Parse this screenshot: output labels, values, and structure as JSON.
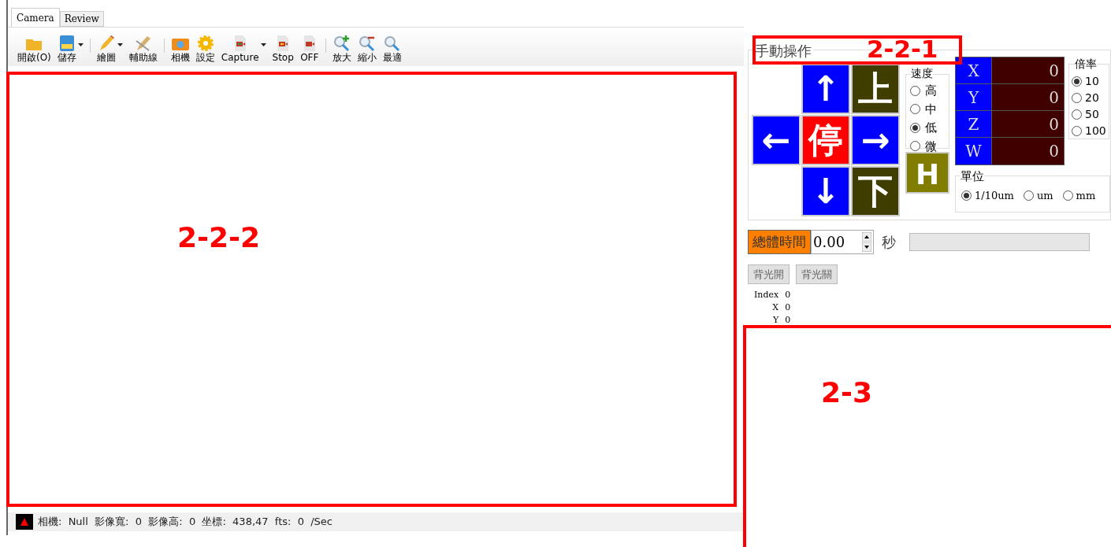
{
  "tabs": [
    {
      "label": "Camera",
      "selected": true
    },
    {
      "label": "Review",
      "selected": false
    }
  ],
  "toolbar": [
    {
      "kind": "button",
      "label": "開啟(O)"
    },
    {
      "kind": "dropdown",
      "label": "儲存"
    },
    {
      "kind": "separator"
    },
    {
      "kind": "dropdown",
      "label": "繪圖"
    },
    {
      "kind": "button",
      "label": "輔助線"
    },
    {
      "kind": "separator"
    },
    {
      "kind": "button",
      "label": "相機"
    },
    {
      "kind": "button",
      "label": "設定"
    },
    {
      "kind": "dropdown",
      "label": "Capture"
    },
    {
      "kind": "button",
      "label": "Stop"
    },
    {
      "kind": "button",
      "label": "OFF"
    },
    {
      "kind": "separator"
    },
    {
      "kind": "button",
      "label": "放大"
    },
    {
      "kind": "button",
      "label": "縮小"
    },
    {
      "kind": "button",
      "label": "最適"
    }
  ],
  "status_bar": {
    "text": "相機:  Null  影像寬:  0  影像高:  0  坐標:  438,47  fts:  0  /Sec"
  },
  "manual": {
    "title": "手動操作",
    "jog_buttons": [
      {
        "label": "↑",
        "color": "#0000ff"
      },
      {
        "label": "上",
        "color": "#403d00"
      },
      {
        "label": "←",
        "color": "#0000ff"
      },
      {
        "label": "停",
        "color": "#ff0000"
      },
      {
        "label": "→",
        "color": "#0000ff"
      },
      {
        "label": "↓",
        "color": "#0000ff"
      },
      {
        "label": "下",
        "color": "#403d00"
      }
    ],
    "speed": {
      "title": "速度",
      "options": [
        {
          "label": "高",
          "selected": false
        },
        {
          "label": "中",
          "selected": false
        },
        {
          "label": "低",
          "selected": true
        },
        {
          "label": "微",
          "selected": false
        }
      ]
    },
    "home_button": "H",
    "axes": [
      {
        "axis": "X",
        "value": "0"
      },
      {
        "axis": "Y",
        "value": "0"
      },
      {
        "axis": "Z",
        "value": "0"
      },
      {
        "axis": "W",
        "value": "0"
      }
    ],
    "magnification": {
      "title": "倍率",
      "options": [
        {
          "label": "10",
          "selected": true
        },
        {
          "label": "20",
          "selected": false
        },
        {
          "label": "50",
          "selected": false
        },
        {
          "label": "100",
          "selected": false
        }
      ]
    },
    "unit": {
      "title": "單位",
      "options": [
        {
          "label": "1/10um",
          "selected": true
        },
        {
          "label": "um",
          "selected": false
        },
        {
          "label": "mm",
          "selected": false
        }
      ]
    }
  },
  "timer": {
    "label": "總體時間",
    "value": "0.00",
    "unit": "秒"
  },
  "backlight_buttons": [
    "背光開",
    "背光關"
  ],
  "info": [
    {
      "label": "Index",
      "value": "0"
    },
    {
      "label": "X",
      "value": "0"
    },
    {
      "label": "Y",
      "value": "0"
    }
  ],
  "annotations": [
    {
      "label": "2-2-1"
    },
    {
      "label": "2-2-2"
    },
    {
      "label": "2-3"
    }
  ]
}
